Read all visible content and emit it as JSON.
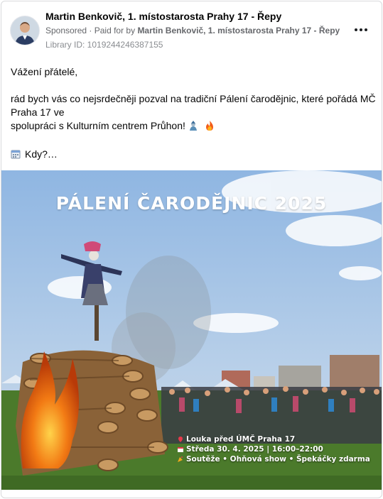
{
  "post": {
    "author": "Martin Benkovič, 1. místostarosta Prahy 17 - Řepy",
    "sponsored": "Sponsored",
    "paid_for_prefix": "· Paid for by",
    "paid_for_name": "Martin Benkovič, 1. místostarosta Prahy 17 - Řepy",
    "library_id": "Library ID: 1019244246387155",
    "more_icon": "more-horizontal-icon"
  },
  "text": {
    "greeting": "Vážení přátelé,",
    "line1": "rád bych vás co nejsrdečněji pozval na tradiční Pálení čarodějnic, které pořádá MČ Praha 17 ve",
    "line2": "spolupráci s Kulturním centrem Průhon!",
    "when": "Kdy?…"
  },
  "poster": {
    "title": "PÁLENÍ ČARODĚJNIC 2025",
    "place": "Louka před ÚMČ Praha 17",
    "date": "Středa 30. 4. 2025 | 16:00–22:00",
    "program": "Soutěže • Ohňová show • Špekáčky zdarma"
  },
  "colors": {
    "muted": "#65676b",
    "sky": "#9fc1e6",
    "grass": "#4f7d2a",
    "fire": "#f26a12"
  }
}
